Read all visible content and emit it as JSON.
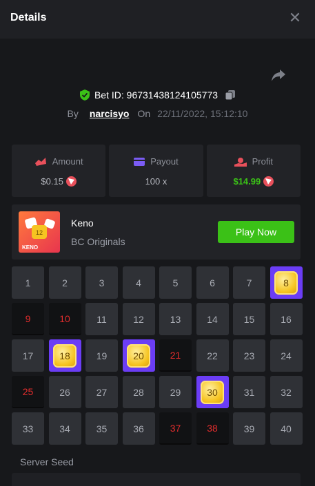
{
  "header": {
    "title": "Details",
    "close_symbol": "✕"
  },
  "bet": {
    "id_label": "Bet ID: 96731438124105773",
    "by_label": "By",
    "username": "narcisyo",
    "on_label": "On",
    "datetime": "22/11/2022, 15:12:10"
  },
  "stats": {
    "amount": {
      "label": "Amount",
      "value": "$0.15"
    },
    "payout": {
      "label": "Payout",
      "value": "100 x"
    },
    "profit": {
      "label": "Profit",
      "value": "$14.99"
    }
  },
  "game": {
    "name": "Keno",
    "provider": "BC Originals",
    "thumb_text": "KENO",
    "thumb_badge": "12",
    "play_button": "Play Now"
  },
  "grid": {
    "cells": [
      {
        "n": "1",
        "s": "none"
      },
      {
        "n": "2",
        "s": "none"
      },
      {
        "n": "3",
        "s": "none"
      },
      {
        "n": "4",
        "s": "none"
      },
      {
        "n": "5",
        "s": "none"
      },
      {
        "n": "6",
        "s": "none"
      },
      {
        "n": "7",
        "s": "none"
      },
      {
        "n": "8",
        "s": "hit"
      },
      {
        "n": "9",
        "s": "miss"
      },
      {
        "n": "10",
        "s": "miss"
      },
      {
        "n": "11",
        "s": "none"
      },
      {
        "n": "12",
        "s": "none"
      },
      {
        "n": "13",
        "s": "none"
      },
      {
        "n": "14",
        "s": "none"
      },
      {
        "n": "15",
        "s": "none"
      },
      {
        "n": "16",
        "s": "none"
      },
      {
        "n": "17",
        "s": "none"
      },
      {
        "n": "18",
        "s": "hit"
      },
      {
        "n": "19",
        "s": "none"
      },
      {
        "n": "20",
        "s": "hit"
      },
      {
        "n": "21",
        "s": "miss"
      },
      {
        "n": "22",
        "s": "none"
      },
      {
        "n": "23",
        "s": "none"
      },
      {
        "n": "24",
        "s": "none"
      },
      {
        "n": "25",
        "s": "miss"
      },
      {
        "n": "26",
        "s": "none"
      },
      {
        "n": "27",
        "s": "none"
      },
      {
        "n": "28",
        "s": "none"
      },
      {
        "n": "29",
        "s": "none"
      },
      {
        "n": "30",
        "s": "hit"
      },
      {
        "n": "31",
        "s": "none"
      },
      {
        "n": "32",
        "s": "none"
      },
      {
        "n": "33",
        "s": "none"
      },
      {
        "n": "34",
        "s": "none"
      },
      {
        "n": "35",
        "s": "none"
      },
      {
        "n": "36",
        "s": "none"
      },
      {
        "n": "37",
        "s": "miss"
      },
      {
        "n": "38",
        "s": "miss"
      },
      {
        "n": "39",
        "s": "none"
      },
      {
        "n": "40",
        "s": "none"
      }
    ]
  },
  "server_seed": {
    "label": "Server Seed"
  },
  "colors": {
    "accent_green": "#3bc117",
    "hit_purple": "#6b3df5",
    "miss_red": "#e22d2d"
  }
}
